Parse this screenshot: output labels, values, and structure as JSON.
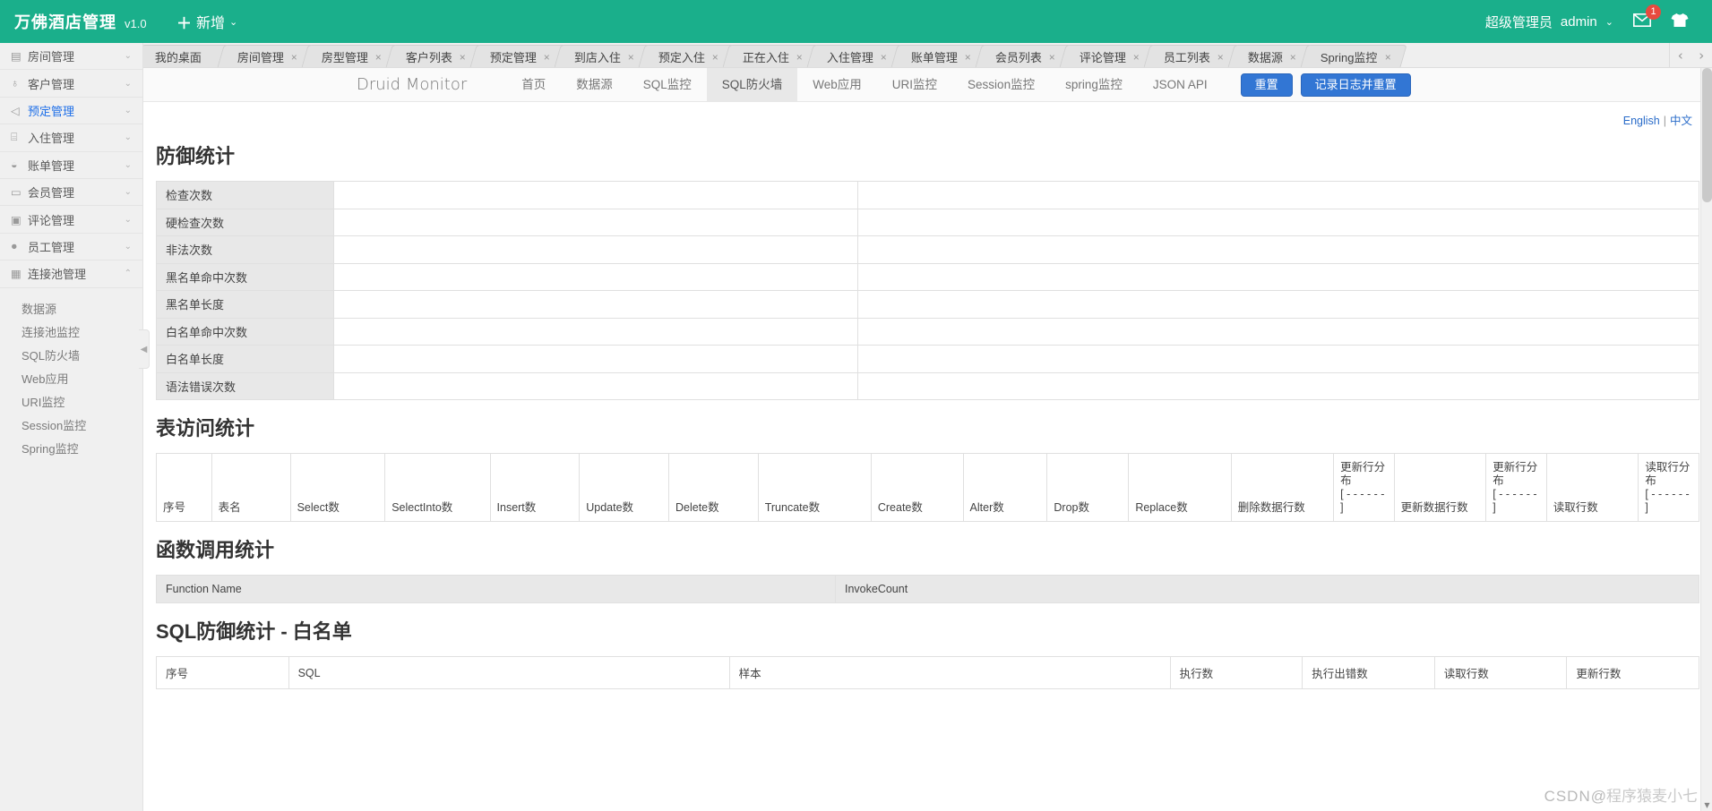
{
  "header": {
    "brand": "万佛酒店管理",
    "version": "v1.0",
    "add_label": "新增",
    "add_plus": "＋",
    "caret": "⌄",
    "role": "超级管理员",
    "username": "admin",
    "message_count": "1",
    "message_icon": "envelope-icon",
    "theme_icon": "shirt-icon",
    "brand_color": "#1aaf8b",
    "badge_color": "#e84a3f"
  },
  "sidebar": {
    "items": [
      {
        "label": "房间管理",
        "icon": "book-icon",
        "arrow": "⌄",
        "active": false
      },
      {
        "label": "客户管理",
        "icon": "user-icon",
        "arrow": "⌄",
        "active": false
      },
      {
        "label": "预定管理",
        "icon": "paper-plane-icon",
        "arrow": "⌄",
        "active": true
      },
      {
        "label": "入住管理",
        "icon": "lock-icon",
        "arrow": "⌄",
        "active": false
      },
      {
        "label": "账单管理",
        "icon": "database-icon",
        "arrow": "⌄",
        "active": false
      },
      {
        "label": "会员管理",
        "icon": "card-icon",
        "arrow": "⌄",
        "active": false
      },
      {
        "label": "评论管理",
        "icon": "comment-icon",
        "arrow": "⌄",
        "active": false
      },
      {
        "label": "员工管理",
        "icon": "person-icon",
        "arrow": "⌄",
        "active": false
      },
      {
        "label": "连接池管理",
        "icon": "grid-icon",
        "arrow": "⌃",
        "active": false
      }
    ],
    "sub_items": [
      {
        "label": "数据源"
      },
      {
        "label": "连接池监控"
      },
      {
        "label": "SQL防火墙"
      },
      {
        "label": "Web应用"
      },
      {
        "label": "URI监控"
      },
      {
        "label": "Session监控"
      },
      {
        "label": "Spring监控"
      }
    ],
    "collapse_handle": "◀"
  },
  "tabbar": {
    "prev_arrow": "‹",
    "next_arrow": "›",
    "close_glyph": "×",
    "tabs": [
      {
        "label": "我的桌面",
        "closable": false
      },
      {
        "label": "房间管理",
        "closable": true
      },
      {
        "label": "房型管理",
        "closable": true
      },
      {
        "label": "客户列表",
        "closable": true
      },
      {
        "label": "预定管理",
        "closable": true
      },
      {
        "label": "到店入住",
        "closable": true
      },
      {
        "label": "预定入住",
        "closable": true
      },
      {
        "label": "正在入住",
        "closable": true
      },
      {
        "label": "入住管理",
        "closable": true
      },
      {
        "label": "账单管理",
        "closable": true
      },
      {
        "label": "会员列表",
        "closable": true
      },
      {
        "label": "评论管理",
        "closable": true
      },
      {
        "label": "员工列表",
        "closable": true
      },
      {
        "label": "数据源",
        "closable": true
      },
      {
        "label": "Spring监控",
        "closable": true
      }
    ]
  },
  "druid": {
    "brand": "Druid Monitor",
    "nav": [
      {
        "label": "首页",
        "active": false
      },
      {
        "label": "数据源",
        "active": false
      },
      {
        "label": "SQL监控",
        "active": false
      },
      {
        "label": "SQL防火墙",
        "active": true
      },
      {
        "label": "Web应用",
        "active": false
      },
      {
        "label": "URI监控",
        "active": false
      },
      {
        "label": "Session监控",
        "active": false
      },
      {
        "label": "spring监控",
        "active": false
      },
      {
        "label": "JSON API",
        "active": false
      }
    ],
    "reset_button": "重置",
    "log_reset_button": "记录日志并重置",
    "button_color": "#3276d4",
    "lang_english": "English",
    "lang_separator": "|",
    "lang_chinese": "中文"
  },
  "defense": {
    "title": "防御统计",
    "rows": [
      {
        "key": "检查次数",
        "v1": "",
        "v2": ""
      },
      {
        "key": "硬检查次数",
        "v1": "",
        "v2": ""
      },
      {
        "key": "非法次数",
        "v1": "",
        "v2": ""
      },
      {
        "key": "黑名单命中次数",
        "v1": "",
        "v2": ""
      },
      {
        "key": "黑名单长度",
        "v1": "",
        "v2": ""
      },
      {
        "key": "白名单命中次数",
        "v1": "",
        "v2": ""
      },
      {
        "key": "白名单长度",
        "v1": "",
        "v2": ""
      },
      {
        "key": "语法错误次数",
        "v1": "",
        "v2": ""
      }
    ]
  },
  "table_access": {
    "title": "表访问统计",
    "columns": [
      "序号",
      "表名",
      "Select数",
      "SelectInto数",
      "Insert数",
      "Update数",
      "Delete数",
      "Truncate数",
      "Create数",
      "Alter数",
      "Drop数",
      "Replace数",
      "删除数据行数",
      "更新行分布\n[ - - - - - - ]",
      "更新数据行数",
      "更新行分布\n[ - - - - - - ]",
      "读取行数",
      "读取行分布\n[ - - - - - - ]"
    ],
    "rows": []
  },
  "func_calls": {
    "title": "函数调用统计",
    "columns": [
      "Function Name",
      "InvokeCount"
    ],
    "rows": []
  },
  "whitelist": {
    "title": "SQL防御统计 - 白名单",
    "columns": [
      "序号",
      "SQL",
      "样本",
      "执行数",
      "执行出错数",
      "读取行数",
      "更新行数"
    ],
    "rows": []
  },
  "watermark": {
    "prefix": "CSDN",
    "at": "@",
    "name": "程序猿麦小七"
  }
}
